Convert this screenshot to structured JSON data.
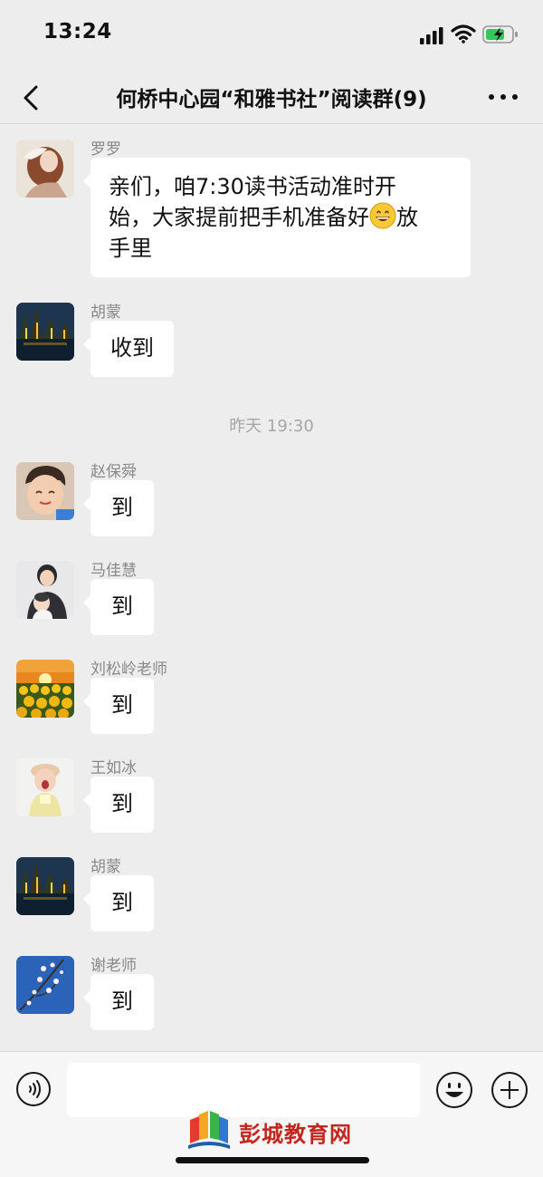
{
  "status_bar": {
    "time": "13:24"
  },
  "header": {
    "title": "何桥中心园“和雅书社”阅读群(9)"
  },
  "messages": [
    {
      "sender": "罗罗",
      "text_before_emoji": "亲们，咱7:30读书活动准时开\n始，大家提前把手机准备好",
      "emoji": "grinning-face-emoji",
      "text_after_emoji": "放\n手里"
    },
    {
      "sender": "胡蒙",
      "text": "收到"
    },
    {
      "sender": "赵保舜",
      "text": "到"
    },
    {
      "sender": "马佳慧",
      "text": "到"
    },
    {
      "sender": "刘松岭老师",
      "text": "到"
    },
    {
      "sender": "王如冰",
      "text": "到"
    },
    {
      "sender": "胡蒙",
      "text": "到"
    },
    {
      "sender": "谢老师",
      "text": "到"
    }
  ],
  "time_divider": "昨天 19:30",
  "input_bar": {
    "value": ""
  },
  "watermark": {
    "text": "彭城教育网"
  },
  "icons": {
    "back": "chevron-left-icon",
    "more": "more-dots-icon",
    "voice": "voice-icon",
    "emoji": "smiley-icon",
    "add": "plus-circle-icon"
  },
  "colors": {
    "background": "#ededed",
    "bubble": "#ffffff",
    "sender_name": "#888888",
    "watermark": "#c0271f"
  }
}
